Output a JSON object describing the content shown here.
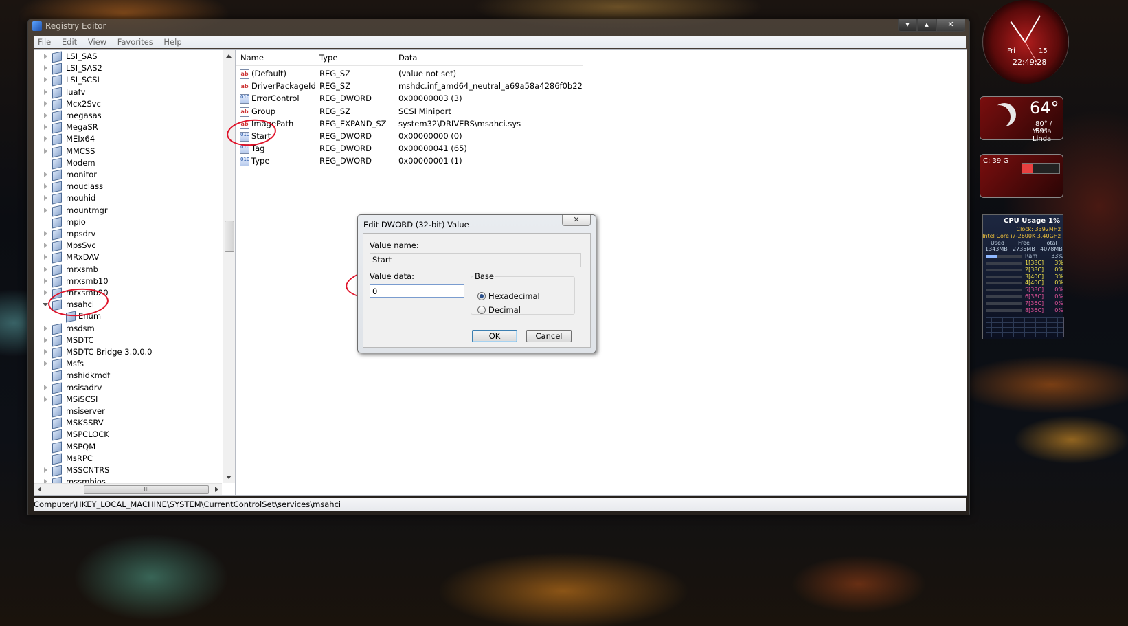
{
  "window": {
    "title": "Registry Editor",
    "min_glyph": "▾",
    "max_glyph": "▴",
    "close_glyph": "✕"
  },
  "menu": [
    "File",
    "Edit",
    "View",
    "Favorites",
    "Help"
  ],
  "tree": [
    {
      "label": "LSI_SAS",
      "expandable": true
    },
    {
      "label": "LSI_SAS2",
      "expandable": true
    },
    {
      "label": "LSI_SCSI",
      "expandable": true
    },
    {
      "label": "luafv",
      "expandable": true
    },
    {
      "label": "Mcx2Svc",
      "expandable": true
    },
    {
      "label": "megasas",
      "expandable": true
    },
    {
      "label": "MegaSR",
      "expandable": true
    },
    {
      "label": "MEIx64",
      "expandable": true
    },
    {
      "label": "MMCSS",
      "expandable": true
    },
    {
      "label": "Modem",
      "expandable": false
    },
    {
      "label": "monitor",
      "expandable": true
    },
    {
      "label": "mouclass",
      "expandable": true
    },
    {
      "label": "mouhid",
      "expandable": true
    },
    {
      "label": "mountmgr",
      "expandable": true
    },
    {
      "label": "mpio",
      "expandable": false
    },
    {
      "label": "mpsdrv",
      "expandable": true
    },
    {
      "label": "MpsSvc",
      "expandable": true
    },
    {
      "label": "MRxDAV",
      "expandable": true
    },
    {
      "label": "mrxsmb",
      "expandable": true
    },
    {
      "label": "mrxsmb10",
      "expandable": true
    },
    {
      "label": "mrxsmb20",
      "expandable": true
    },
    {
      "label": "msahci",
      "expandable": true,
      "open": true
    },
    {
      "label": "Enum",
      "child": true
    },
    {
      "label": "msdsm",
      "expandable": true
    },
    {
      "label": "MSDTC",
      "expandable": true
    },
    {
      "label": "MSDTC Bridge 3.0.0.0",
      "expandable": true
    },
    {
      "label": "Msfs",
      "expandable": true
    },
    {
      "label": "mshidkmdf",
      "expandable": false
    },
    {
      "label": "msisadrv",
      "expandable": true
    },
    {
      "label": "MSiSCSI",
      "expandable": true
    },
    {
      "label": "msiserver",
      "expandable": false
    },
    {
      "label": "MSKSSRV",
      "expandable": false
    },
    {
      "label": "MSPCLOCK",
      "expandable": false
    },
    {
      "label": "MSPQM",
      "expandable": false
    },
    {
      "label": "MsRPC",
      "expandable": false
    },
    {
      "label": "MSSCNTRS",
      "expandable": true
    },
    {
      "label": "mssmbios",
      "expandable": true
    }
  ],
  "tree_hscroll_grip": "III",
  "values": {
    "columns": [
      "Name",
      "Type",
      "Data"
    ],
    "rows": [
      {
        "icon": "ab",
        "name": "(Default)",
        "type": "REG_SZ",
        "data": "(value not set)"
      },
      {
        "icon": "ab",
        "name": "DriverPackageId",
        "type": "REG_SZ",
        "data": "mshdc.inf_amd64_neutral_a69a58a4286f0b22"
      },
      {
        "icon": "dw",
        "name": "ErrorControl",
        "type": "REG_DWORD",
        "data": "0x00000003 (3)"
      },
      {
        "icon": "ab",
        "name": "Group",
        "type": "REG_SZ",
        "data": "SCSI Miniport"
      },
      {
        "icon": "ab",
        "name": "ImagePath",
        "type": "REG_EXPAND_SZ",
        "data": "system32\\DRIVERS\\msahci.sys"
      },
      {
        "icon": "dw",
        "name": "Start",
        "type": "REG_DWORD",
        "data": "0x00000000 (0)"
      },
      {
        "icon": "dw",
        "name": "Tag",
        "type": "REG_DWORD",
        "data": "0x00000041 (65)"
      },
      {
        "icon": "dw",
        "name": "Type",
        "type": "REG_DWORD",
        "data": "0x00000001 (1)"
      }
    ]
  },
  "status": "Computer\\HKEY_LOCAL_MACHINE\\SYSTEM\\CurrentControlSet\\services\\msahci",
  "dialog": {
    "title": "Edit DWORD (32-bit) Value",
    "close_glyph": "✕",
    "value_name_label": "Value name:",
    "value_name": "Start",
    "value_data_label": "Value data:",
    "value_data": "0",
    "base_label": "Base",
    "hex_label": "Hexadecimal",
    "dec_label": "Decimal",
    "ok_label": "OK",
    "cancel_label": "Cancel"
  },
  "gadgets": {
    "clock": {
      "day": "Fri",
      "date": "15",
      "time": "22:49:28"
    },
    "weather": {
      "temp": "64°",
      "range": "80° / 59°",
      "city": "Yorba Linda"
    },
    "drive": {
      "label": "C: 39 G",
      "used_fraction": 0.3
    },
    "cpu": {
      "title": "CPU Usage",
      "pct": "1%",
      "clock": "Clock: 3392MHz",
      "model": "Intel Core i7-2600K 3.40GHz",
      "ram_head": [
        "Used",
        "Free",
        "Total"
      ],
      "ram_vals": [
        "1343MB",
        "2735MB",
        "4078MB"
      ],
      "ram_label": "Ram",
      "ram_pct": "33%",
      "cores": [
        {
          "label": "1[38C]",
          "val": "3%",
          "color": "#f2e14a"
        },
        {
          "label": "2[38C]",
          "val": "0%",
          "color": "#f2e14a"
        },
        {
          "label": "3[40C]",
          "val": "3%",
          "color": "#f2e14a"
        },
        {
          "label": "4[40C]",
          "val": "0%",
          "color": "#f2e14a"
        },
        {
          "label": "5[38C]",
          "val": "0%",
          "color": "#e6529a"
        },
        {
          "label": "6[38C]",
          "val": "0%",
          "color": "#e6529a"
        },
        {
          "label": "7[36C]",
          "val": "0%",
          "color": "#e6529a"
        },
        {
          "label": "8[36C]",
          "val": "0%",
          "color": "#e6529a"
        }
      ]
    }
  },
  "colors": {
    "annotation": "#e0142a",
    "dialog_focus": "#3c7fb1"
  }
}
